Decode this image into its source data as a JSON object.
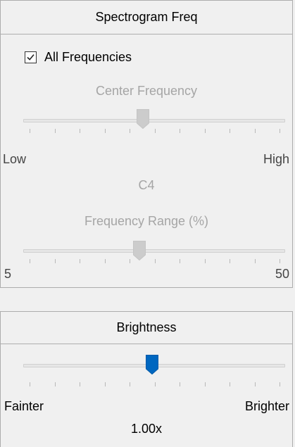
{
  "spectrogram": {
    "title": "Spectrogram Freq",
    "all_frequencies": {
      "label": "All Frequencies",
      "checked": true
    },
    "center_frequency": {
      "label": "Center Frequency",
      "min_label": "Low",
      "max_label": "High",
      "value_label": "C4",
      "position_fraction": 0.46,
      "enabled": false
    },
    "frequency_range": {
      "label": "Frequency Range (%)",
      "min_label": "5",
      "max_label": "50",
      "position_fraction": 0.45,
      "enabled": false
    }
  },
  "brightness": {
    "title": "Brightness",
    "min_label": "Fainter",
    "max_label": "Brighter",
    "value_label": "1.00x",
    "position_fraction": 0.5,
    "accent_color": "#0067c0"
  },
  "colors": {
    "background": "#f0f0f0",
    "border": "#adadad",
    "disabled_text": "#a5a5a5",
    "disabled_thumb": "#cccccc"
  }
}
